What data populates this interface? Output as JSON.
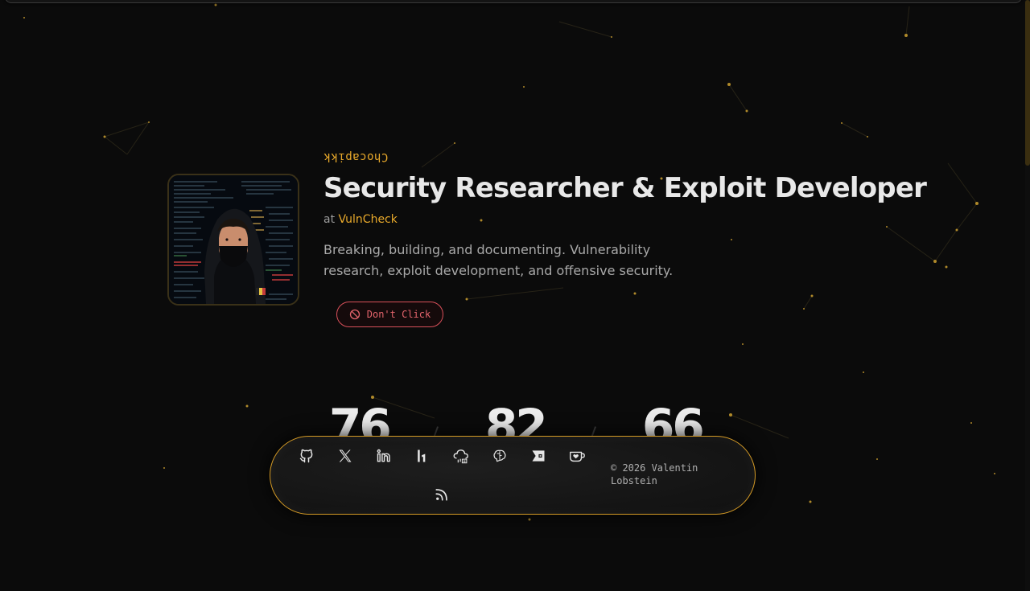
{
  "hero": {
    "handle": "Chocapikk",
    "title": "Security Researcher & Exploit Developer",
    "company_prefix": "at",
    "company_name": "VulnCheck",
    "bio": "Breaking, building, and documenting. Vulnerability research, exploit development, and offensive security.",
    "cta_label": "Don't Click"
  },
  "stats": [
    "76",
    "82",
    "66"
  ],
  "footer": {
    "social_links": [
      {
        "icon": "github-icon"
      },
      {
        "icon": "x-twitter-icon"
      },
      {
        "icon": "linkedin-icon"
      },
      {
        "icon": "hackerone-icon"
      },
      {
        "icon": "cloud-cve-icon"
      },
      {
        "icon": "brain-icon"
      },
      {
        "icon": "bugcrowd-icon"
      },
      {
        "icon": "ko-fi-cup-icon"
      },
      {
        "icon": "rss-icon"
      }
    ],
    "copyright": "© 2026 Valentin Lobstein"
  },
  "colors": {
    "background": "#0b0b0b",
    "accent": "#e8a92b",
    "danger": "#e4646c",
    "title": "#e8e8e8",
    "muted": "#a9a9a9"
  }
}
